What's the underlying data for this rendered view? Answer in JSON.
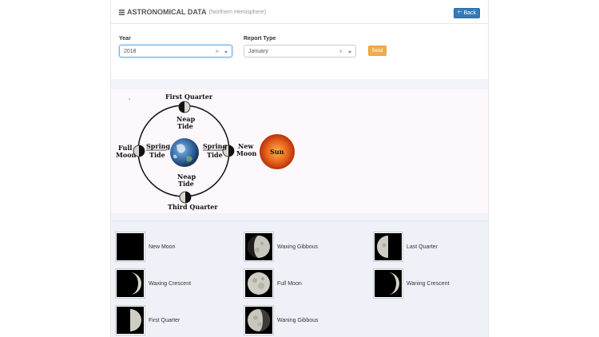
{
  "header": {
    "title": "ASTRONOMICAL DATA",
    "subtitle": "(Northern Hemisphere)",
    "back_label": "Back"
  },
  "form": {
    "year_label": "Year",
    "year_value": "2018",
    "report_type_label": "Report Type",
    "report_type_value": "January",
    "send_label": "Send"
  },
  "diagram": {
    "first_quarter": "First Quarter",
    "third_quarter": "Third Quarter",
    "full_moon_1": "Full",
    "full_moon_2": "Moon",
    "new_moon_1": "New",
    "new_moon_2": "Moon",
    "neap_tide_top_1": "Neap",
    "neap_tide_top_2": "Tide",
    "neap_tide_bottom_1": "Neap",
    "neap_tide_bottom_2": "Tide",
    "spring_tide_left_1": "Spring",
    "spring_tide_left_2": "Tide",
    "spring_tide_right_1": "Spring",
    "spring_tide_right_2": "Tide",
    "sun_label": "Sun"
  },
  "phases": [
    {
      "label": "New Moon",
      "icon": "new-moon-icon"
    },
    {
      "label": "Waxing Gibbous",
      "icon": "waxing-gibbous-icon"
    },
    {
      "label": "Last Quarter",
      "icon": "last-quarter-icon"
    },
    {
      "label": "Waxing Crescent",
      "icon": "waxing-crescent-icon"
    },
    {
      "label": "Full Moon",
      "icon": "full-moon-icon"
    },
    {
      "label": "Waning Crescent",
      "icon": "waning-crescent-icon"
    },
    {
      "label": "First Quarter",
      "icon": "first-quarter-icon"
    },
    {
      "label": "Waning Gibbous",
      "icon": "waning-gibbous-icon"
    }
  ],
  "colors": {
    "back_button": "#337ab7",
    "send_button": "#f0ad4e",
    "sun": "#e0561c"
  }
}
